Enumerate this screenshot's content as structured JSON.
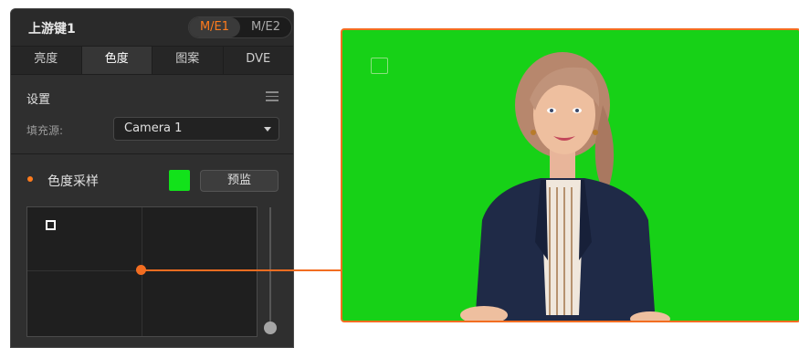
{
  "panel": {
    "title": "上游键1",
    "me_options": [
      "M/E1",
      "M/E2"
    ],
    "me_selected": "M/E1",
    "tabs": [
      "亮度",
      "色度",
      "图案",
      "DVE"
    ],
    "active_tab": "色度",
    "settings_label": "设置",
    "fill_source_label": "填充源:",
    "fill_source_value": "Camera 1",
    "chroma_sample_label": "色度采样",
    "chroma_sample_color": "#12e21a",
    "preview_button": "预监"
  },
  "colors": {
    "accent": "#f26d21",
    "key_green": "#17d117",
    "panel_bg": "#2f2f2f"
  }
}
